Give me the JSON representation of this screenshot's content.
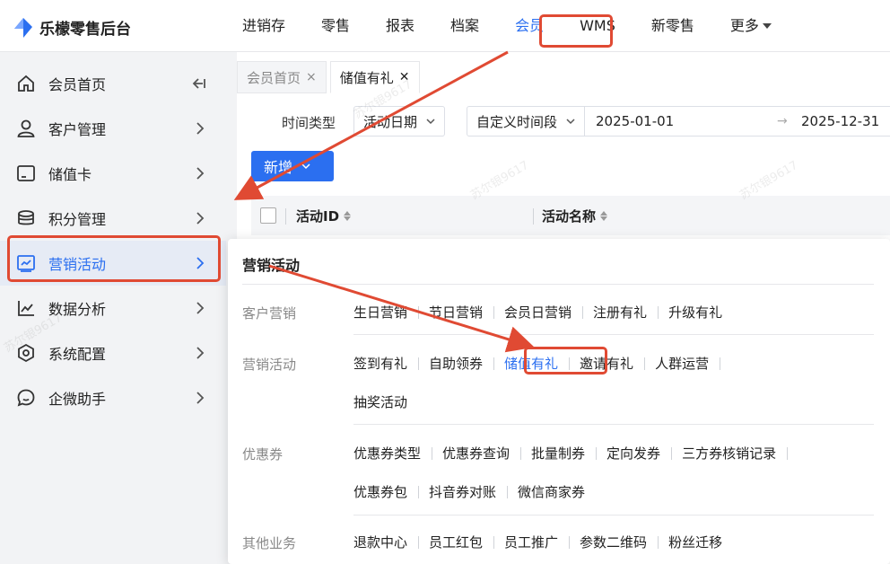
{
  "app": {
    "title": "乐檬零售后台"
  },
  "topnav": {
    "items": [
      "进销存",
      "零售",
      "报表",
      "档案",
      "会员",
      "WMS",
      "新零售",
      "更多"
    ],
    "active_index": 4
  },
  "sidebar": {
    "items": [
      {
        "label": "会员首页",
        "icon": "home-icon"
      },
      {
        "label": "客户管理",
        "icon": "user-icon"
      },
      {
        "label": "储值卡",
        "icon": "card-icon"
      },
      {
        "label": "积分管理",
        "icon": "coin-icon"
      },
      {
        "label": "营销活动",
        "icon": "chart-screen-icon"
      },
      {
        "label": "数据分析",
        "icon": "line-chart-icon"
      },
      {
        "label": "系统配置",
        "icon": "hex-gear-icon"
      },
      {
        "label": "企微助手",
        "icon": "chat-icon"
      }
    ],
    "active_index": 4
  },
  "tabs": [
    {
      "label": "会员首页",
      "close": "×"
    },
    {
      "label": "储值有礼",
      "close": "✕"
    }
  ],
  "filters": {
    "time_type_label": "时间类型",
    "time_type_value": "活动日期",
    "range_type_value": "自定义时间段",
    "start_date": "2025-01-01",
    "end_date": "2025-12-31",
    "range_separator": "→"
  },
  "toolbar": {
    "new_label": "新增"
  },
  "table": {
    "columns": [
      "活动ID",
      "活动名称"
    ]
  },
  "popup": {
    "title": "营销活动",
    "groups": [
      {
        "label": "客户营销",
        "rows": [
          [
            "生日营销",
            "节日营销",
            "会员日营销",
            "注册有礼",
            "升级有礼"
          ]
        ]
      },
      {
        "label": "营销活动",
        "rows": [
          [
            "签到有礼",
            "自助领券",
            "储值有礼",
            "邀请有礼",
            "人群运营"
          ],
          [
            "抽奖活动"
          ]
        ]
      },
      {
        "label": "优惠券",
        "rows": [
          [
            "优惠券类型",
            "优惠券查询",
            "批量制券",
            "定向发券",
            "三方券核销记录"
          ],
          [
            "优惠券包",
            "抖音券对账",
            "微信商家券"
          ]
        ]
      },
      {
        "label": "其他业务",
        "rows": [
          [
            "退款中心",
            "员工红包",
            "员工推广",
            "参数二维码",
            "粉丝迁移"
          ]
        ]
      }
    ],
    "active_link": "储值有礼"
  },
  "watermark": "苏尔银9617",
  "colors": {
    "accent": "#2b6ff0",
    "annotation": "#e04a33"
  }
}
